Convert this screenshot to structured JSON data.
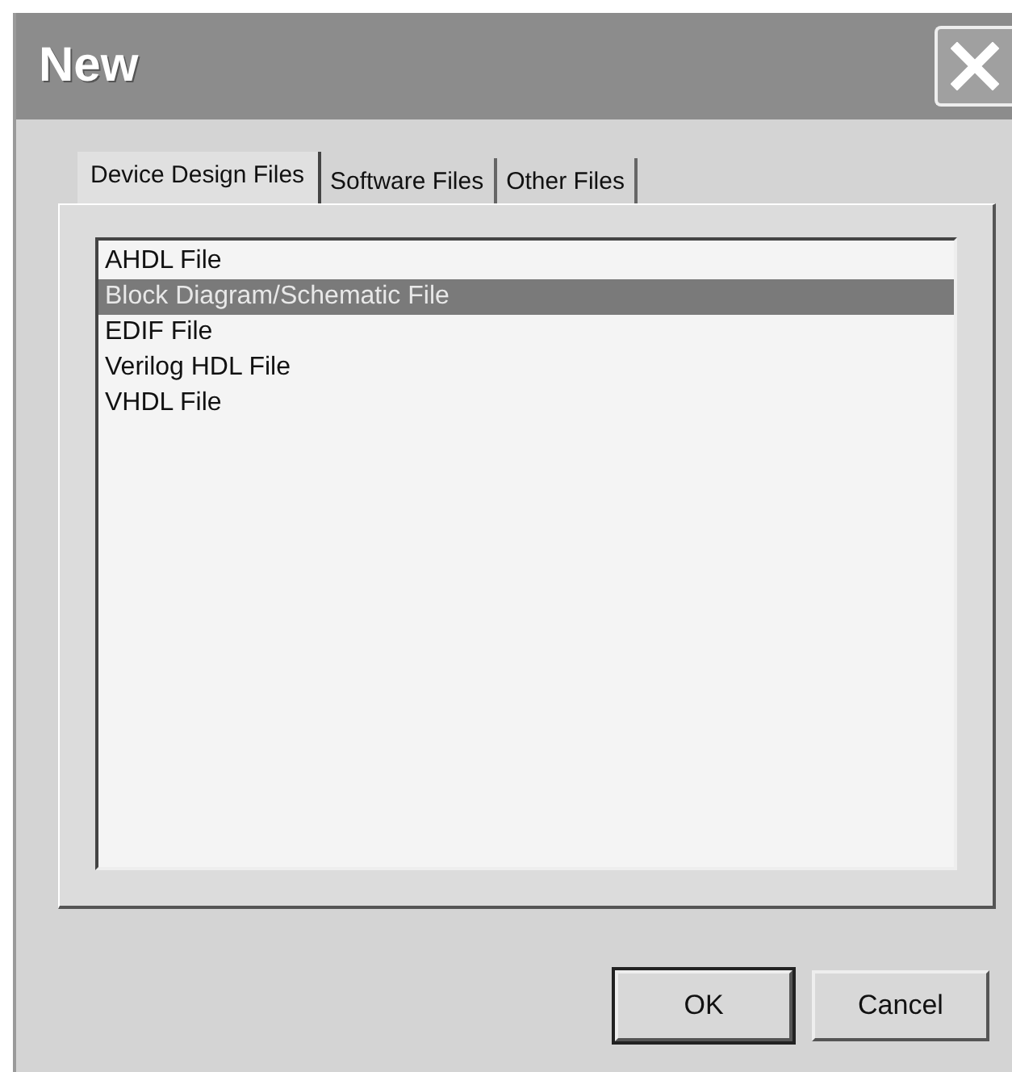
{
  "window": {
    "title": "New"
  },
  "tabs": [
    {
      "label": "Device Design Files",
      "selected": true
    },
    {
      "label": "Software Files",
      "selected": false
    },
    {
      "label": "Other Files",
      "selected": false
    }
  ],
  "files": [
    {
      "label": "AHDL File",
      "selected": false
    },
    {
      "label": "Block Diagram/Schematic File",
      "selected": true
    },
    {
      "label": "EDIF File",
      "selected": false
    },
    {
      "label": "Verilog HDL File",
      "selected": false
    },
    {
      "label": "VHDL File",
      "selected": false
    }
  ],
  "buttons": [
    {
      "label": "OK",
      "kind": "default"
    },
    {
      "label": "Cancel",
      "kind": "normal"
    }
  ]
}
